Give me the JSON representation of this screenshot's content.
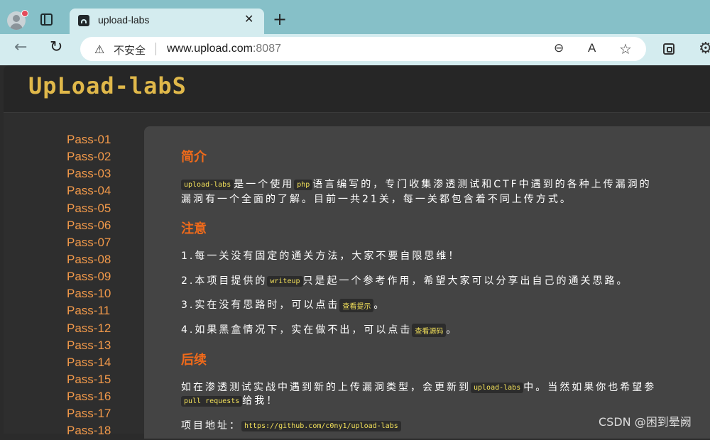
{
  "browser": {
    "tab_title": "upload-labs",
    "tab_close": "✕",
    "new_tab": "+",
    "insecure_label": "不安全",
    "url_host": "www.upload.com",
    "url_port": ":8087"
  },
  "header": {
    "logo": "UpLoad-labS"
  },
  "sidebar": {
    "items": [
      "Pass-01",
      "Pass-02",
      "Pass-03",
      "Pass-04",
      "Pass-05",
      "Pass-06",
      "Pass-07",
      "Pass-08",
      "Pass-09",
      "Pass-10",
      "Pass-11",
      "Pass-12",
      "Pass-13",
      "Pass-14",
      "Pass-15",
      "Pass-16",
      "Pass-17",
      "Pass-18"
    ]
  },
  "content": {
    "intro_title": "简介",
    "intro_code1": "upload-labs",
    "intro_text1": "是一个使用",
    "intro_code2": "php",
    "intro_text2": "语言编写的，专门收集渗透测试和CTF中遇到的各种上传漏洞的",
    "intro_line2": "漏洞有一个全面的了解。目前一共21关，每一关都包含着不同上传方式。",
    "notice_title": "注意",
    "notice1": "1.每一关没有固定的通关方法，大家不要自限思维！",
    "notice2_a": "2.本项目提供的",
    "notice2_code": "writeup",
    "notice2_b": "只是起一个参考作用，希望大家可以分享出自己的通关思路。",
    "notice3_a": "3.实在没有思路时，可以点击",
    "notice3_code": "查看提示",
    "notice3_b": "。",
    "notice4_a": "4.如果黑盒情况下，实在做不出，可以点击",
    "notice4_code": "查看源码",
    "notice4_b": "。",
    "follow_title": "后续",
    "follow_a": "如在渗透测试实战中遇到新的上传漏洞类型，会更新到",
    "follow_code": "upload-labs",
    "follow_b": "中。当然如果你也希望参",
    "follow_code2": "pull requests",
    "follow_c": "给我！",
    "repo_label": "项目地址：",
    "repo_url": "https://github.com/c0ny1/upload-labs"
  },
  "watermark": "CSDN @困到晕阙"
}
